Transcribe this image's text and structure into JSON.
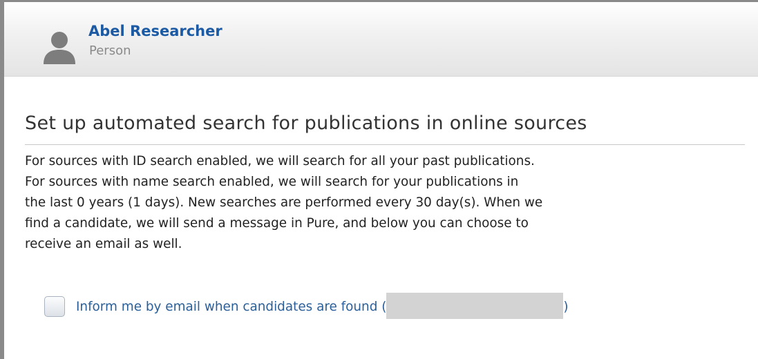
{
  "person": {
    "name": "Abel Researcher",
    "type": "Person"
  },
  "section": {
    "title": "Set up automated search for publications in online sources",
    "description_lines": [
      "For sources with ID search enabled, we will search for all your past publications.",
      "For sources with name search enabled, we will search for your publications in",
      "the last 0 years (1 days). New searches are performed every 30 day(s). When we",
      "find a candidate, we will send a message in Pure, and below you can choose to",
      "receive an email as well."
    ]
  },
  "email_option": {
    "label": "Inform me by email when candidates are found (",
    "close_paren": ")",
    "checked": false
  },
  "icons": {
    "avatar": "person-silhouette-icon"
  },
  "colors": {
    "name_link": "#1c5aa3",
    "option_text": "#2a5f99",
    "redaction": "#d3d3d3"
  }
}
